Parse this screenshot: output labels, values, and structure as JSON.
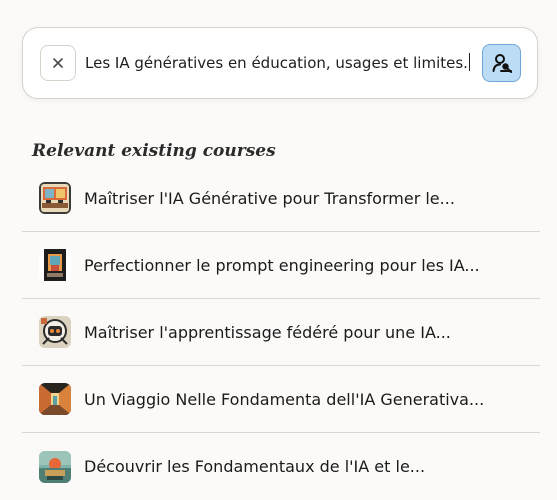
{
  "search": {
    "value": "Les IA génératives en éducation, usages et limites.",
    "clear_icon": "close-icon",
    "submit_icon": "user-search-icon"
  },
  "section": {
    "title": "Relevant existing courses"
  },
  "courses": [
    {
      "title": "Maîtriser l'IA Générative pour Transformer le...",
      "icon": "classroom-thumbnail"
    },
    {
      "title": "Perfectionner le prompt engineering pour les IA...",
      "icon": "doorway-thumbnail"
    },
    {
      "title": "Maîtriser l'apprentissage fédéré pour une IA...",
      "icon": "robot-thumbnail"
    },
    {
      "title": "Un Viaggio Nelle Fondamenta dell'IA Generativa...",
      "icon": "hallway-thumbnail"
    },
    {
      "title": "Découvrir les Fondamentaux de l'IA et le...",
      "icon": "sunset-thumbnail"
    }
  ],
  "colors": {
    "accent": "#bcdcf6",
    "accent_border": "#6fa8d8",
    "background": "#fbfaf8"
  }
}
